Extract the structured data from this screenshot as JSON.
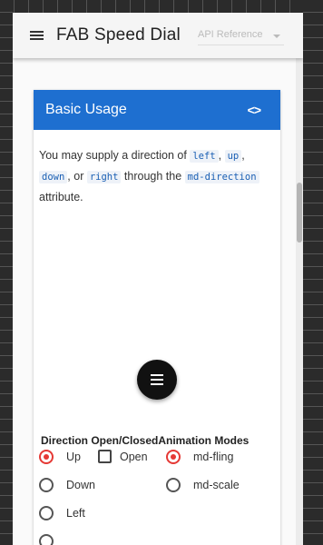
{
  "toolbar": {
    "title": "FAB Speed Dial",
    "api_select": "API Reference"
  },
  "card": {
    "title": "Basic Usage",
    "code_toggle": "<>"
  },
  "description": {
    "text1": "You may supply a direction of ",
    "code_left": "left",
    "sep1": ", ",
    "code_up": "up",
    "sep2": ",",
    "code_down": "down",
    "sep3": ", or ",
    "code_right": "right",
    "text2": " through the ",
    "code_attr": "md-direction",
    "text3": "attribute."
  },
  "options": {
    "header": "Direction Open/ClosedAnimation Modes",
    "directions": [
      "Up",
      "Down",
      "Left"
    ],
    "selected_direction": "Up",
    "open_label": "Open",
    "open_checked": false,
    "animations": [
      "md-fling",
      "md-scale"
    ],
    "selected_animation": "md-fling"
  },
  "colors": {
    "header_blue": "#1e6fd0",
    "radio_accent": "#e53935"
  }
}
